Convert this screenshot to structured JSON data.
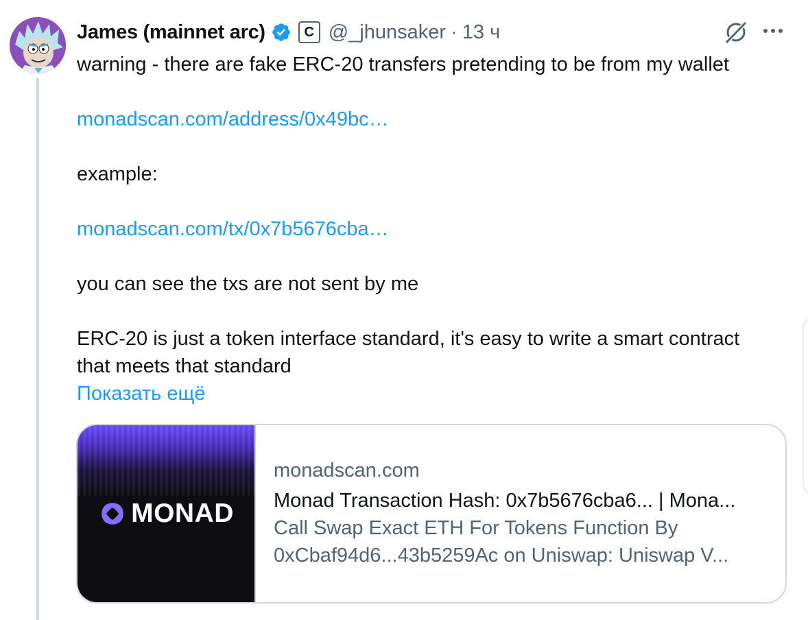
{
  "tweet": {
    "display_name": "James (mainnet arc)",
    "affiliate_badge": "C",
    "handle": "@_jhunsaker",
    "separator": "·",
    "time": "13 ч",
    "lines": [
      {
        "text": "warning - there are fake ERC-20 transfers pretending to be from my wallet",
        "type": "text"
      },
      {
        "text": "",
        "type": "blank"
      },
      {
        "text": "monadscan.com/address/0x49bc…",
        "type": "link"
      },
      {
        "text": "",
        "type": "blank"
      },
      {
        "text": "example:",
        "type": "text"
      },
      {
        "text": "",
        "type": "blank"
      },
      {
        "text": "monadscan.com/tx/0x7b5676cba…",
        "type": "link"
      },
      {
        "text": "",
        "type": "blank"
      },
      {
        "text": "you can see the txs are not sent by me",
        "type": "text"
      },
      {
        "text": "",
        "type": "blank"
      },
      {
        "text": "ERC-20 is just a token interface standard, it's easy to write a smart contract",
        "type": "text"
      },
      {
        "text": "that meets that standard",
        "type": "text"
      }
    ],
    "show_more": "Показать ещё"
  },
  "card": {
    "logo_text": "MONAD",
    "domain": "monadscan.com",
    "title": "Monad Transaction Hash: 0x7b5676cba6... | Mona...",
    "desc_line1": "Call Swap Exact ETH For Tokens Function By",
    "desc_line2": "0xCbaf94d6...43b5259Ac on Uniswap: Uniswap V..."
  },
  "icons": {
    "verified": "verified-badge-icon",
    "grok": "grok-icon",
    "more": "more-options-icon"
  },
  "colors": {
    "link": "#1d9bf0",
    "secondary_text": "#536471",
    "primary_text": "#0f1419",
    "border": "#cfd9de",
    "verified": "#1d9bf0",
    "monad_purple": "#836ef9"
  }
}
